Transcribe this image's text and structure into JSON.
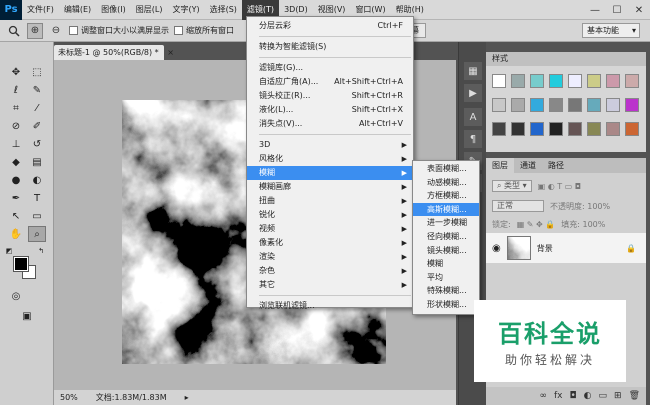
{
  "app": {
    "logo": "Ps"
  },
  "menubar": {
    "items": [
      "文件(F)",
      "编辑(E)",
      "图像(I)",
      "图层(L)",
      "文字(Y)",
      "选择(S)",
      "滤镜(T)",
      "3D(D)",
      "视图(V)",
      "窗口(W)",
      "帮助(H)"
    ],
    "active_index": 6
  },
  "window_controls": {
    "minimize": "—",
    "maximize": "☐",
    "close": "✕"
  },
  "options_bar": {
    "resize_windows_label": "调整窗口大小以满屏显示",
    "zoom_all_windows_label": "缩放所有窗口",
    "fill_screen_button": "填充屏幕",
    "workspace_select": "基本功能"
  },
  "document": {
    "tab_title": "未标题-1 @ 50%(RGB/8) *",
    "tab_close": "×",
    "zoom": "50%",
    "doc_info": "文档:1.83M/1.83M",
    "canvas_image": "black-and-white-clouds-render"
  },
  "filter_menu": {
    "items": [
      {
        "label": "分层云彩",
        "shortcut": "Ctrl+F"
      },
      {
        "sep": true
      },
      {
        "label": "转换为智能滤镜(S)"
      },
      {
        "sep": true
      },
      {
        "label": "滤镜库(G)..."
      },
      {
        "label": "自适应广角(A)...",
        "shortcut": "Alt+Shift+Ctrl+A"
      },
      {
        "label": "镜头校正(R)...",
        "shortcut": "Shift+Ctrl+R"
      },
      {
        "label": "液化(L)...",
        "shortcut": "Shift+Ctrl+X"
      },
      {
        "label": "消失点(V)...",
        "shortcut": "Alt+Ctrl+V"
      },
      {
        "sep": true
      },
      {
        "label": "3D",
        "submenu": true
      },
      {
        "label": "风格化",
        "submenu": true
      },
      {
        "label": "模糊",
        "submenu": true,
        "highlighted": true
      },
      {
        "label": "模糊画廊",
        "submenu": true
      },
      {
        "label": "扭曲",
        "submenu": true
      },
      {
        "label": "锐化",
        "submenu": true
      },
      {
        "label": "视频",
        "submenu": true
      },
      {
        "label": "像素化",
        "submenu": true
      },
      {
        "label": "渲染",
        "submenu": true
      },
      {
        "label": "杂色",
        "submenu": true
      },
      {
        "label": "其它",
        "submenu": true
      },
      {
        "sep": true
      },
      {
        "label": "浏览联机滤镜..."
      }
    ]
  },
  "blur_submenu": {
    "items": [
      {
        "label": "表面模糊..."
      },
      {
        "label": "动感模糊..."
      },
      {
        "label": "方框模糊..."
      },
      {
        "label": "高斯模糊...",
        "highlighted": true
      },
      {
        "label": "进一步模糊"
      },
      {
        "label": "径向模糊..."
      },
      {
        "label": "镜头模糊..."
      },
      {
        "label": "模糊"
      },
      {
        "label": "平均"
      },
      {
        "label": "特殊模糊..."
      },
      {
        "label": "形状模糊..."
      }
    ]
  },
  "styles_panel": {
    "title": "样式"
  },
  "layers_panel": {
    "tabs": [
      "图层",
      "通道",
      "路径"
    ],
    "kind_filter": "类型",
    "blend_mode": "正常",
    "opacity_label": "不透明度: 100%",
    "lock_label": "锁定:",
    "fill_label": "填充: 100%",
    "layer_name": "背景",
    "bottom_icons": [
      "∞",
      "fx",
      "◘",
      "◐",
      "▭",
      "⊞",
      "🗑"
    ]
  },
  "watermark": {
    "title": "百科全说",
    "subtitle": "助你轻松解决"
  },
  "colors": {
    "accent": "#3b8ef0",
    "watermark_green": "#1a9f6a"
  }
}
